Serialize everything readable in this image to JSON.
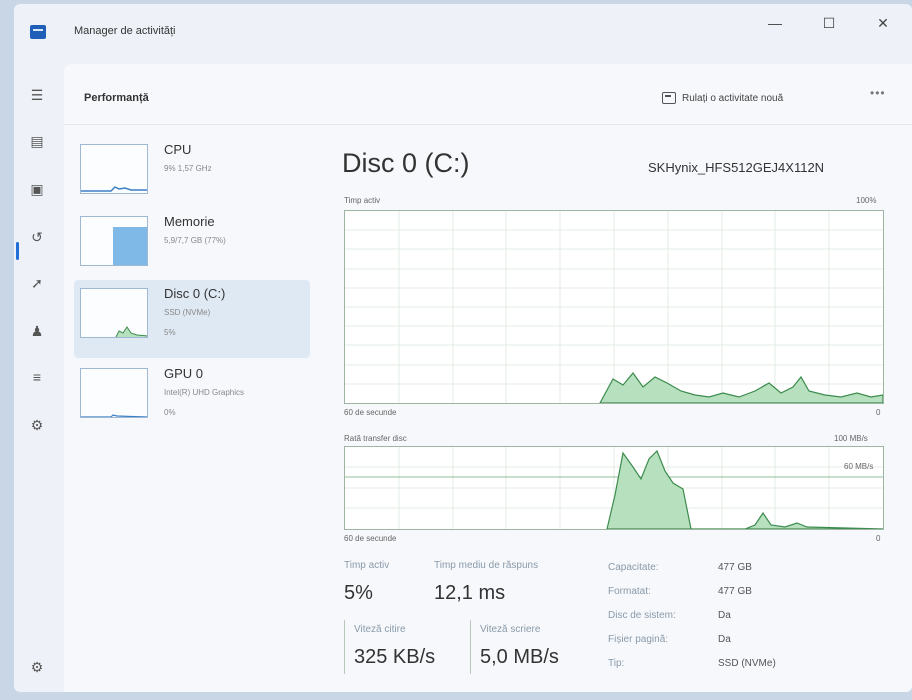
{
  "window": {
    "title": "Manager de activități",
    "minimize": "—",
    "maximize": "☐",
    "close": "✕"
  },
  "rail": [
    {
      "name": "hamburger-icon",
      "glyph": "☰"
    },
    {
      "name": "processes-icon",
      "glyph": "▤"
    },
    {
      "name": "performance-icon",
      "glyph": "▣"
    },
    {
      "name": "app-history-icon",
      "glyph": "↺"
    },
    {
      "name": "startup-apps-icon",
      "glyph": "➚"
    },
    {
      "name": "users-icon",
      "glyph": "♟"
    },
    {
      "name": "details-icon",
      "glyph": "≡"
    },
    {
      "name": "services-icon",
      "glyph": "⚙"
    },
    {
      "name": "settings-icon",
      "glyph": "⚙"
    }
  ],
  "header": {
    "page_title": "Performanță",
    "run_task": "Rulați o activitate nouă",
    "more": "•••"
  },
  "devices": [
    {
      "name": "CPU",
      "line1": "9% 1,57 GHz",
      "line2": ""
    },
    {
      "name": "Memorie",
      "line1": "5,9/7,7 GB (77%)",
      "line2": ""
    },
    {
      "name": "Disc 0 (C:)",
      "line1": "SSD (NVMe)",
      "line2": "5%"
    },
    {
      "name": "GPU 0",
      "line1": "Intel(R) UHD Graphics",
      "line2": "0%"
    }
  ],
  "detail": {
    "title": "Disc 0 (C:)",
    "model": "SKHynix_HFS512GEJ4X112N",
    "graph1": {
      "label": "Timp activ",
      "max": "100%",
      "time": "60 de secunde",
      "min": "0"
    },
    "graph2": {
      "label": "Rată transfer disc",
      "max": "100 MB/s",
      "mid": "60 MB/s",
      "time": "60 de secunde",
      "min": "0"
    }
  },
  "stats": {
    "active_time_label": "Timp activ",
    "active_time": "5%",
    "response_label": "Timp mediu de răspuns",
    "response": "12,1 ms",
    "read_label": "Viteză citire",
    "read": "325 KB/s",
    "write_label": "Viteză scriere",
    "write": "5,0 MB/s"
  },
  "properties": [
    {
      "label": "Capacitate:",
      "value": "477 GB"
    },
    {
      "label": "Formatat:",
      "value": "477 GB"
    },
    {
      "label": "Disc de sistem:",
      "value": "Da"
    },
    {
      "label": "Fișier pagină:",
      "value": "Da"
    },
    {
      "label": "Tip:",
      "value": "SSD (NVMe)"
    }
  ],
  "colors": {
    "graph_fill": "#b7e0bf",
    "graph_stroke": "#3c8c4d",
    "accent": "#1f6fd6",
    "memory_fill": "#7fb9e8"
  }
}
